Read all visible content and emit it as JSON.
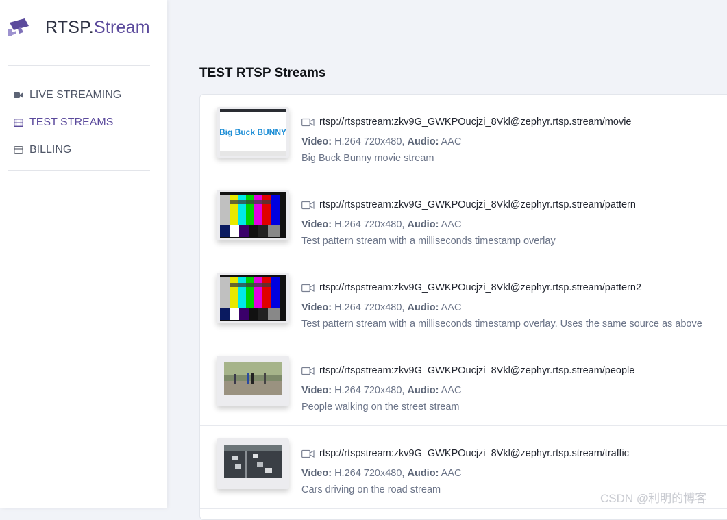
{
  "brand": {
    "prefix": "RTSP.",
    "suffix": "Stream"
  },
  "nav": [
    {
      "label": "LIVE STREAMING",
      "icon": "video-camera-icon",
      "active": false
    },
    {
      "label": "TEST STREAMS",
      "icon": "film-icon",
      "active": true
    },
    {
      "label": "BILLING",
      "icon": "credit-card-icon",
      "active": false
    }
  ],
  "page_title": "TEST RTSP Streams",
  "streams": [
    {
      "url": "rtsp://rtspstream:zkv9G_GWKPOucjzi_8Vkl@zephyr.rtsp.stream/movie",
      "video_label": "Video:",
      "video": "H.264 720x480,",
      "audio_label": "Audio:",
      "audio": "AAC",
      "description": "Big Buck Bunny movie stream",
      "thumb": "big-buck-bunny-thumbnail",
      "thumb_text": "Big Buck BUNNY"
    },
    {
      "url": "rtsp://rtspstream:zkv9G_GWKPOucjzi_8Vkl@zephyr.rtsp.stream/pattern",
      "video_label": "Video:",
      "video": "H.264 720x480,",
      "audio_label": "Audio:",
      "audio": "AAC",
      "description": "Test pattern stream with a milliseconds timestamp overlay",
      "thumb": "test-pattern-thumbnail"
    },
    {
      "url": "rtsp://rtspstream:zkv9G_GWKPOucjzi_8Vkl@zephyr.rtsp.stream/pattern2",
      "video_label": "Video:",
      "video": "H.264 720x480,",
      "audio_label": "Audio:",
      "audio": "AAC",
      "description": "Test pattern stream with a milliseconds timestamp overlay. Uses the same source as above",
      "thumb": "test-pattern-thumbnail"
    },
    {
      "url": "rtsp://rtspstream:zkv9G_GWKPOucjzi_8Vkl@zephyr.rtsp.stream/people",
      "video_label": "Video:",
      "video": "H.264 720x480,",
      "audio_label": "Audio:",
      "audio": "AAC",
      "description": "People walking on the street stream",
      "thumb": "people-street-thumbnail"
    },
    {
      "url": "rtsp://rtspstream:zkv9G_GWKPOucjzi_8Vkl@zephyr.rtsp.stream/traffic",
      "video_label": "Video:",
      "video": "H.264 720x480,",
      "audio_label": "Audio:",
      "audio": "AAC",
      "description": "Cars driving on the road stream",
      "thumb": "traffic-road-thumbnail"
    }
  ],
  "watermark": "CSDN @利明的博客",
  "colors": {
    "accent": "#5b4a9c",
    "text": "#505768",
    "muted": "#6b7488"
  }
}
